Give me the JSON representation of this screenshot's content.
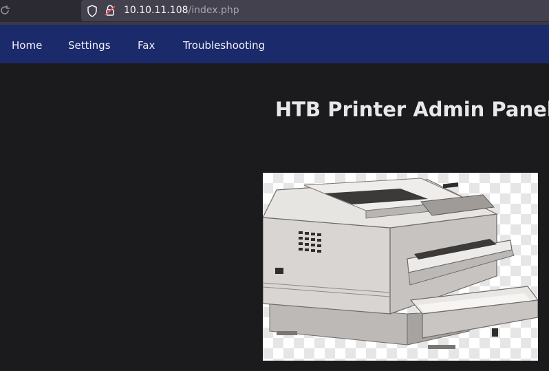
{
  "browser": {
    "url_host": "10.10.11.108",
    "url_path": "/index.php"
  },
  "nav": {
    "items": [
      {
        "label": "Home"
      },
      {
        "label": "Settings"
      },
      {
        "label": "Fax"
      },
      {
        "label": "Troubleshooting"
      }
    ]
  },
  "main": {
    "title": "HTB Printer Admin Panel",
    "image": {
      "subject": "office printer illustration"
    }
  },
  "colors": {
    "nav_bg": "#1b2a6b",
    "page_bg": "#1b1b1e",
    "chrome_bg": "#2b2a33"
  }
}
